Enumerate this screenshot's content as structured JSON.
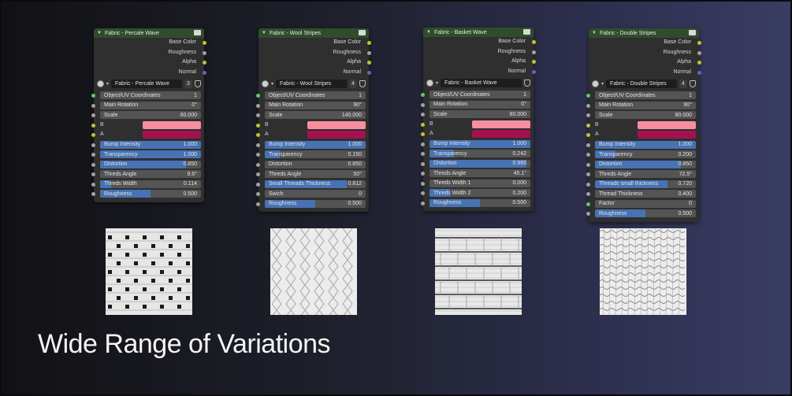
{
  "headline": "Wide Range of Variations",
  "colors": {
    "swatch_b": "#f78e9e",
    "swatch_a": "#a3114f",
    "slider_fill": "#4772b3",
    "header": "#2f4d2b"
  },
  "nodes": [
    {
      "title": "Fabric - Percale Wave",
      "outputs": [
        "Base Color",
        "Roughness",
        "Alpha",
        "Normal"
      ],
      "group_name": "Fabric - Percale Wave",
      "users": "3",
      "fields_top": [
        {
          "label": "Object/UV Coordinates",
          "value": "1"
        },
        {
          "label": "Main Rotation",
          "value": "0°"
        },
        {
          "label": "Scale",
          "value": "60.000"
        }
      ],
      "colors": [
        {
          "label": "B"
        },
        {
          "label": "A"
        }
      ],
      "fields_bottom": [
        {
          "label": "Bump Intensity",
          "value": "1.000"
        },
        {
          "label": "Transparency",
          "value": "1.000"
        },
        {
          "label": "Distortion",
          "value": "0.850"
        },
        {
          "label": "Threds Angle",
          "value": "9.6°"
        },
        {
          "label": "Threds Width",
          "value": "0.114"
        },
        {
          "label": "Roughness",
          "value": "0.500"
        }
      ]
    },
    {
      "title": "Fabric - Wool Stripes",
      "outputs": [
        "Base Color",
        "Roughness",
        "Alpha",
        "Normal"
      ],
      "group_name": "Fabric - Wool Stripes",
      "users": "4",
      "fields_top": [
        {
          "label": "Object/UV Coordinates",
          "value": "1"
        },
        {
          "label": "Main Rotation",
          "value": "90°"
        },
        {
          "label": "Scale",
          "value": "140.000"
        }
      ],
      "colors": [
        {
          "label": "B"
        },
        {
          "label": "A"
        }
      ],
      "fields_bottom": [
        {
          "label": "Bump Intensity",
          "value": "1.000"
        },
        {
          "label": "Transparency",
          "value": "0.150"
        },
        {
          "label": "Distortion",
          "value": "0.850"
        },
        {
          "label": "Threds Angle",
          "value": "50°"
        },
        {
          "label": "Small Threads Thickness",
          "value": "0.812"
        },
        {
          "label": "Swich",
          "value": "0"
        },
        {
          "label": "Roughness",
          "value": "0.500"
        }
      ]
    },
    {
      "title": "Fabric - Basket Wave",
      "outputs": [
        "Base Color",
        "Roughness",
        "Alpha",
        "Normal"
      ],
      "group_name": "Fabric - Basket Wave",
      "users": "",
      "fields_top": [
        {
          "label": "Object/UV Coordinates",
          "value": "1"
        },
        {
          "label": "Main Rotation",
          "value": "0°"
        },
        {
          "label": "Scale",
          "value": "80.000"
        }
      ],
      "colors": [
        {
          "label": "B"
        },
        {
          "label": "A"
        }
      ],
      "fields_bottom": [
        {
          "label": "Bump Intensity",
          "value": "1.000"
        },
        {
          "label": "Transparency",
          "value": "0.242"
        },
        {
          "label": "Distortion",
          "value": "0.965"
        },
        {
          "label": "Threds Angle",
          "value": "45.1°"
        },
        {
          "label": "Threds Width 1",
          "value": "0.000"
        },
        {
          "label": "Threds Width 2",
          "value": "0.200"
        },
        {
          "label": "Roughness",
          "value": "0.500"
        }
      ]
    },
    {
      "title": "Fabric - Double Stripes",
      "outputs": [
        "Base Color",
        "Roughness",
        "Alpha",
        "Normal"
      ],
      "group_name": "Fabric - Double Stripes",
      "users": "4",
      "fields_top": [
        {
          "label": "Object/UV Coordinates",
          "value": "1"
        },
        {
          "label": "Main Rotation",
          "value": "90°"
        },
        {
          "label": "Scale",
          "value": "80.000"
        }
      ],
      "colors": [
        {
          "label": "B"
        },
        {
          "label": "A"
        }
      ],
      "fields_bottom": [
        {
          "label": "Bump Intensity",
          "value": "1.000"
        },
        {
          "label": "Transparency",
          "value": "0.200"
        },
        {
          "label": "Distortion",
          "value": "0.850"
        },
        {
          "label": "Threds Angle",
          "value": "72.5°"
        },
        {
          "label": "Threads small thickness",
          "value": "0.720"
        },
        {
          "label": "Thread Thickness",
          "value": "0.400"
        },
        {
          "label": "Factor",
          "value": "0"
        },
        {
          "label": "Roughness",
          "value": "0.500"
        }
      ]
    }
  ]
}
